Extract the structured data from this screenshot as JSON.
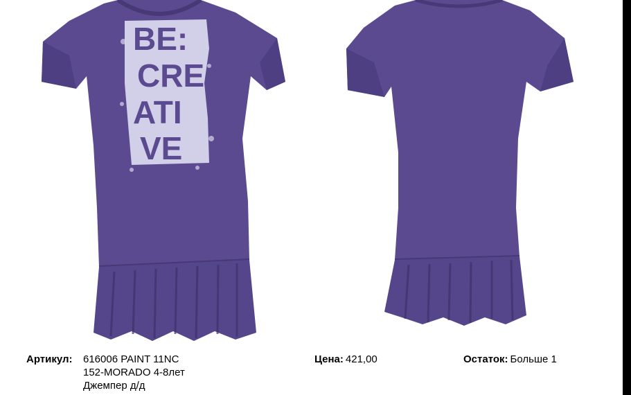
{
  "product": {
    "print_text": [
      "BE:",
      "CRE",
      "ATI",
      "VE"
    ],
    "colors": {
      "garment": "#5b4a90",
      "garment_shadow": "#473876",
      "print": "#d9d6ee"
    }
  },
  "article": {
    "label": "Артикул:",
    "lines": [
      "616006 PAINT 11NC",
      "152-MORADO 4-8лет",
      "Джемпер д/д"
    ]
  },
  "price": {
    "label": "Цена:",
    "value": "421,00"
  },
  "stock": {
    "label": "Остаток:",
    "value": "Больше 1"
  }
}
